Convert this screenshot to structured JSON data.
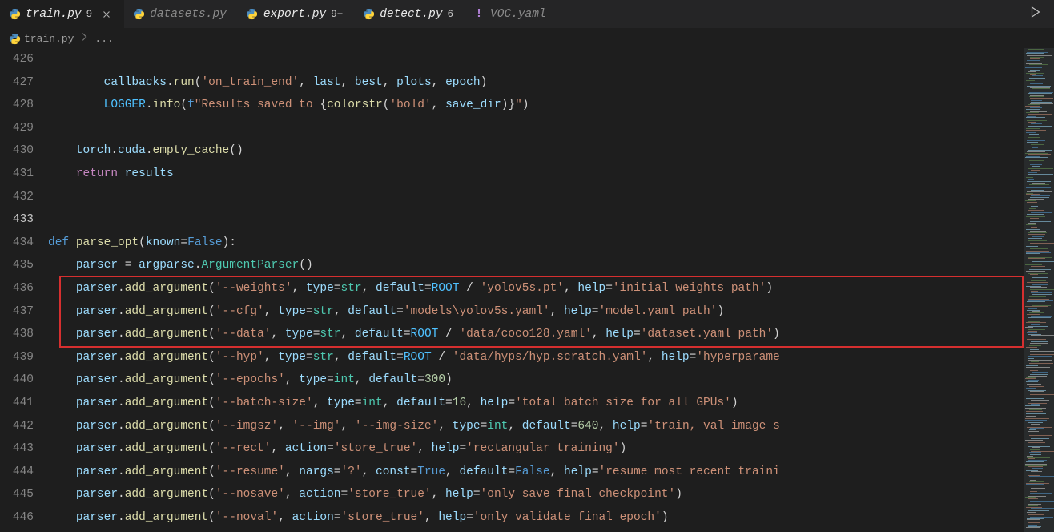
{
  "tabs": [
    {
      "icon": "python",
      "name": "train.py",
      "badge": "9",
      "close": true,
      "active": true,
      "modified": true
    },
    {
      "icon": "python",
      "name": "datasets.py",
      "badge": "",
      "close": false,
      "active": false,
      "modified": false
    },
    {
      "icon": "python",
      "name": "export.py",
      "badge": "9+",
      "close": false,
      "active": false,
      "modified": true
    },
    {
      "icon": "python",
      "name": "detect.py",
      "badge": "6",
      "close": false,
      "active": false,
      "modified": true
    },
    {
      "icon": "yaml",
      "name": "VOC.yaml",
      "badge": "",
      "close": false,
      "active": false,
      "modified": false
    }
  ],
  "breadcrumb": {
    "file": "train.py",
    "more": "..."
  },
  "lines": [
    {
      "n": 426,
      "html": ""
    },
    {
      "n": 427,
      "html": "        <span class=c-var>callbacks</span><span class=c-punct>.</span><span class=c-fn>run</span><span class=c-punct>(</span><span class=c-str>'on_train_end'</span><span class=c-punct>, </span><span class=c-var>last</span><span class=c-punct>, </span><span class=c-var>best</span><span class=c-punct>, </span><span class=c-var>plots</span><span class=c-punct>, </span><span class=c-var>epoch</span><span class=c-punct>)</span>"
    },
    {
      "n": 428,
      "html": "        <span class=c-const>LOGGER</span><span class=c-punct>.</span><span class=c-fn>info</span><span class=c-punct>(</span><span class=c-kw>f</span><span class=c-str>\"Results saved to </span><span class=c-punct>{</span><span class=c-fn>colorstr</span><span class=c-punct>(</span><span class=c-str>'bold'</span><span class=c-punct>, </span><span class=c-var>save_dir</span><span class=c-punct>)}</span><span class=c-str>\"</span><span class=c-punct>)</span>"
    },
    {
      "n": 429,
      "html": ""
    },
    {
      "n": 430,
      "html": "    <span class=c-var>torch</span><span class=c-punct>.</span><span class=c-var>cuda</span><span class=c-punct>.</span><span class=c-fn>empty_cache</span><span class=c-punct>()</span>"
    },
    {
      "n": 431,
      "html": "    <span class=c-kw2>return</span> <span class=c-var>results</span>"
    },
    {
      "n": 432,
      "html": ""
    },
    {
      "n": 433,
      "html": "",
      "cur": true
    },
    {
      "n": 434,
      "html": "<span class=c-kw>def</span> <span class=c-fn>parse_opt</span><span class=c-punct>(</span><span class=c-param>known</span><span class=c-op>=</span><span class=c-kw>False</span><span class=c-punct>):</span>"
    },
    {
      "n": 435,
      "html": "    <span class=c-var>parser</span> <span class=c-op>=</span> <span class=c-var>argparse</span><span class=c-punct>.</span><span class=c-cls>ArgumentParser</span><span class=c-punct>()</span>"
    },
    {
      "n": 436,
      "html": "    <span class=c-var>parser</span><span class=c-punct>.</span><span class=c-fn>add_argument</span><span class=c-punct>(</span><span class=c-str>'--weights'</span><span class=c-punct>, </span><span class=c-param>type</span><span class=c-op>=</span><span class=c-cls>str</span><span class=c-punct>, </span><span class=c-param>default</span><span class=c-op>=</span><span class=c-const>ROOT</span> <span class=c-op>/</span> <span class=c-str>'yolov5s.pt'</span><span class=c-punct>, </span><span class=c-param>help</span><span class=c-op>=</span><span class=c-str>'initial weights path'</span><span class=c-punct>)</span>"
    },
    {
      "n": 437,
      "html": "    <span class=c-var>parser</span><span class=c-punct>.</span><span class=c-fn>add_argument</span><span class=c-punct>(</span><span class=c-str>'--cfg'</span><span class=c-punct>, </span><span class=c-param>type</span><span class=c-op>=</span><span class=c-cls>str</span><span class=c-punct>, </span><span class=c-param>default</span><span class=c-op>=</span><span class=c-str>'models\\yolov5s.yaml'</span><span class=c-punct>, </span><span class=c-param>help</span><span class=c-op>=</span><span class=c-str>'model.yaml path'</span><span class=c-punct>)</span>"
    },
    {
      "n": 438,
      "html": "    <span class=c-var>parser</span><span class=c-punct>.</span><span class=c-fn>add_argument</span><span class=c-punct>(</span><span class=c-str>'--data'</span><span class=c-punct>, </span><span class=c-param>type</span><span class=c-op>=</span><span class=c-cls>str</span><span class=c-punct>, </span><span class=c-param>default</span><span class=c-op>=</span><span class=c-const>ROOT</span> <span class=c-op>/</span> <span class=c-str>'data/coco128.yaml'</span><span class=c-punct>, </span><span class=c-param>help</span><span class=c-op>=</span><span class=c-str>'dataset.yaml path'</span><span class=c-punct>)</span>"
    },
    {
      "n": 439,
      "html": "    <span class=c-var>parser</span><span class=c-punct>.</span><span class=c-fn>add_argument</span><span class=c-punct>(</span><span class=c-str>'--hyp'</span><span class=c-punct>, </span><span class=c-param>type</span><span class=c-op>=</span><span class=c-cls>str</span><span class=c-punct>, </span><span class=c-param>default</span><span class=c-op>=</span><span class=c-const>ROOT</span> <span class=c-op>/</span> <span class=c-str>'data/hyps/hyp.scratch.yaml'</span><span class=c-punct>, </span><span class=c-param>help</span><span class=c-op>=</span><span class=c-str>'hyperparame</span>"
    },
    {
      "n": 440,
      "html": "    <span class=c-var>parser</span><span class=c-punct>.</span><span class=c-fn>add_argument</span><span class=c-punct>(</span><span class=c-str>'--epochs'</span><span class=c-punct>, </span><span class=c-param>type</span><span class=c-op>=</span><span class=c-cls>int</span><span class=c-punct>, </span><span class=c-param>default</span><span class=c-op>=</span><span class=c-num>300</span><span class=c-punct>)</span>"
    },
    {
      "n": 441,
      "html": "    <span class=c-var>parser</span><span class=c-punct>.</span><span class=c-fn>add_argument</span><span class=c-punct>(</span><span class=c-str>'--batch-size'</span><span class=c-punct>, </span><span class=c-param>type</span><span class=c-op>=</span><span class=c-cls>int</span><span class=c-punct>, </span><span class=c-param>default</span><span class=c-op>=</span><span class=c-num>16</span><span class=c-punct>, </span><span class=c-param>help</span><span class=c-op>=</span><span class=c-str>'total batch size for all GPUs'</span><span class=c-punct>)</span>"
    },
    {
      "n": 442,
      "html": "    <span class=c-var>parser</span><span class=c-punct>.</span><span class=c-fn>add_argument</span><span class=c-punct>(</span><span class=c-str>'--imgsz'</span><span class=c-punct>, </span><span class=c-str>'--img'</span><span class=c-punct>, </span><span class=c-str>'--img-size'</span><span class=c-punct>, </span><span class=c-param>type</span><span class=c-op>=</span><span class=c-cls>int</span><span class=c-punct>, </span><span class=c-param>default</span><span class=c-op>=</span><span class=c-num>640</span><span class=c-punct>, </span><span class=c-param>help</span><span class=c-op>=</span><span class=c-str>'train, val image s</span>"
    },
    {
      "n": 443,
      "html": "    <span class=c-var>parser</span><span class=c-punct>.</span><span class=c-fn>add_argument</span><span class=c-punct>(</span><span class=c-str>'--rect'</span><span class=c-punct>, </span><span class=c-param>action</span><span class=c-op>=</span><span class=c-str>'store_true'</span><span class=c-punct>, </span><span class=c-param>help</span><span class=c-op>=</span><span class=c-str>'rectangular training'</span><span class=c-punct>)</span>"
    },
    {
      "n": 444,
      "html": "    <span class=c-var>parser</span><span class=c-punct>.</span><span class=c-fn>add_argument</span><span class=c-punct>(</span><span class=c-str>'--resume'</span><span class=c-punct>, </span><span class=c-param>nargs</span><span class=c-op>=</span><span class=c-str>'?'</span><span class=c-punct>, </span><span class=c-param>const</span><span class=c-op>=</span><span class=c-kw>True</span><span class=c-punct>, </span><span class=c-param>default</span><span class=c-op>=</span><span class=c-kw>False</span><span class=c-punct>, </span><span class=c-param>help</span><span class=c-op>=</span><span class=c-str>'resume most recent traini</span>"
    },
    {
      "n": 445,
      "html": "    <span class=c-var>parser</span><span class=c-punct>.</span><span class=c-fn>add_argument</span><span class=c-punct>(</span><span class=c-str>'--nosave'</span><span class=c-punct>, </span><span class=c-param>action</span><span class=c-op>=</span><span class=c-str>'store_true'</span><span class=c-punct>, </span><span class=c-param>help</span><span class=c-op>=</span><span class=c-str>'only save final checkpoint'</span><span class=c-punct>)</span>"
    },
    {
      "n": 446,
      "html": "    <span class=c-var>parser</span><span class=c-punct>.</span><span class=c-fn>add_argument</span><span class=c-punct>(</span><span class=c-str>'--noval'</span><span class=c-punct>, </span><span class=c-param>action</span><span class=c-op>=</span><span class=c-str>'store_true'</span><span class=c-punct>, </span><span class=c-param>help</span><span class=c-op>=</span><span class=c-str>'only validate final epoch'</span><span class=c-punct>)</span>"
    }
  ],
  "highlight": {
    "from": 436,
    "to": 438
  }
}
